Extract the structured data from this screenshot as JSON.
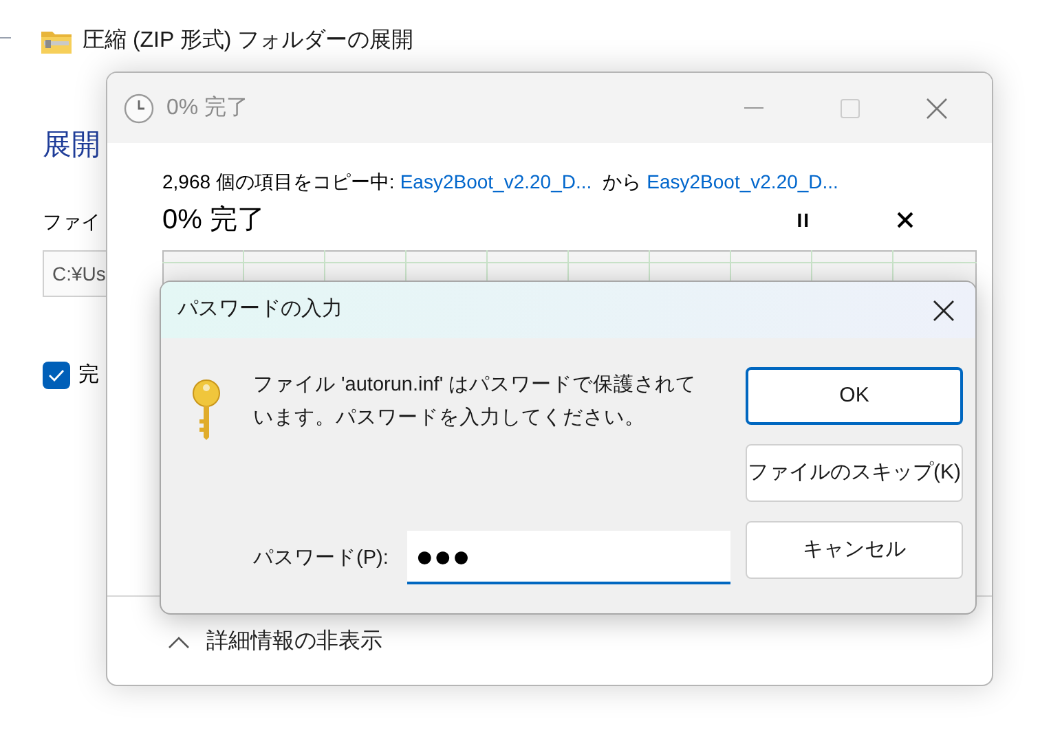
{
  "background_window": {
    "title": "圧縮 (ZIP 形式) フォルダーの展開",
    "heading": "展開",
    "field_label": "ファイ",
    "path_field": {
      "value": "C:¥Us"
    },
    "checkbox": {
      "label": "完",
      "checked": true
    }
  },
  "progress_window": {
    "title": "0% 完了",
    "status": {
      "prefix": "2,968 個の項目をコピー中:",
      "source": "Easy2Boot_v2.20_D...",
      "middle": "から",
      "destination": "Easy2Boot_v2.20_D..."
    },
    "percent": "0% 完了",
    "pause": "II",
    "details_toggle": "詳細情報の非表示"
  },
  "password_dialog": {
    "title": "パスワードの入力",
    "message": "ファイル 'autorun.inf' はパスワードで保護されています。パスワードを入力してください。",
    "password_label": "パスワード(P):",
    "password_value": "●●●",
    "buttons": [
      {
        "label": "OK",
        "default": true
      },
      {
        "label": "ファイルのスキップ(K)",
        "default": false
      },
      {
        "label": "キャンセル",
        "default": false
      }
    ]
  }
}
